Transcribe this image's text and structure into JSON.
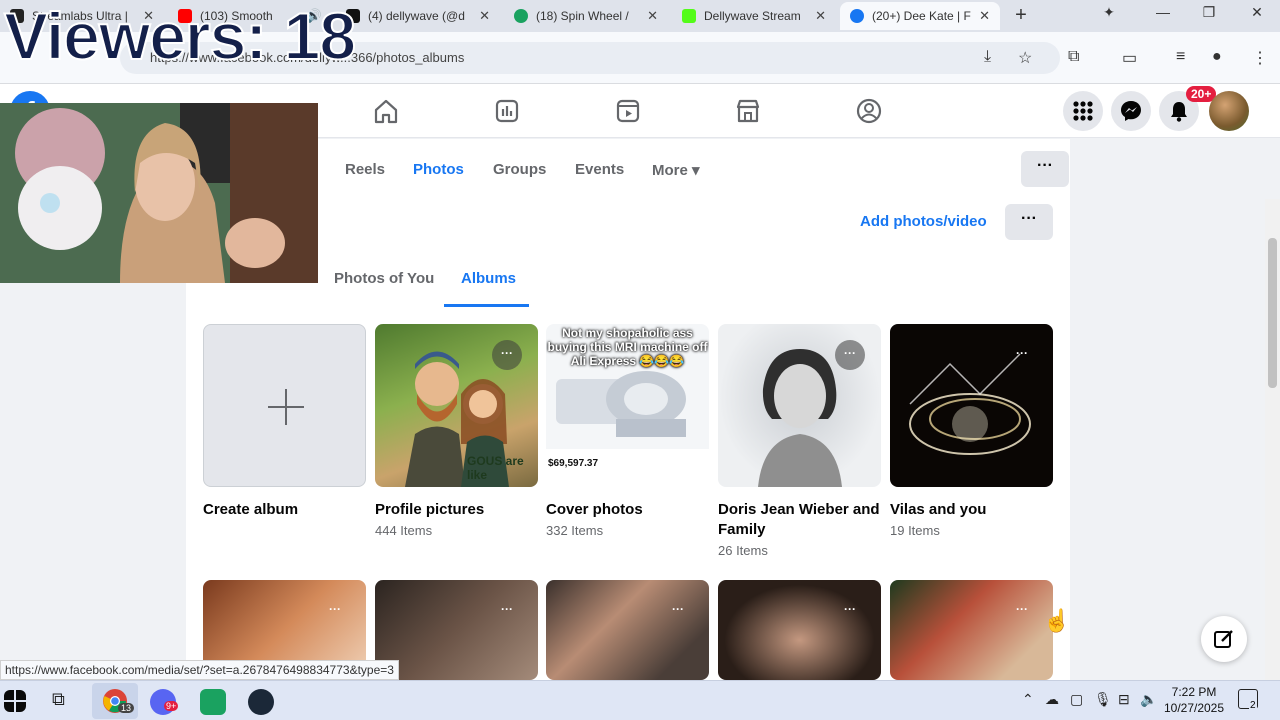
{
  "browser": {
    "tabs": [
      {
        "label": "Streamlabs Ultra |",
        "color": "#222222"
      },
      {
        "label": "(103) Smooth",
        "color": "#ff0000"
      },
      {
        "label": "(4) dellywave (@d",
        "color": "#111111"
      },
      {
        "label": "(18) Spin Wheel /",
        "color": "#1aa260"
      },
      {
        "label": "Dellywave Stream",
        "color": "#53fc18"
      },
      {
        "label": "(20+) Dee Kate | F",
        "color": "#1877f2"
      }
    ],
    "url": "https://www.facebook.com/dellyw...366/photos_albums",
    "status_url": "https://www.facebook.com/media/set/?set=a.2678476498834773&type=3"
  },
  "overlay": {
    "viewers_text": "Viewers: 18"
  },
  "facebook": {
    "notifications_badge": "20+",
    "profile_nav": [
      {
        "label": "Reels",
        "active": false
      },
      {
        "label": "Photos",
        "active": true
      },
      {
        "label": "Groups",
        "active": false
      },
      {
        "label": "Events",
        "active": false
      },
      {
        "label": "More ▾",
        "active": false
      }
    ],
    "add_photos_label": "Add photos/video",
    "more_dots": "···",
    "subtabs": [
      {
        "label": "Photos of You",
        "active": false
      },
      {
        "label": "Albums",
        "active": true
      }
    ],
    "albums": [
      {
        "title": "Create album",
        "count": ""
      },
      {
        "title": "Profile pictures",
        "count": "444 Items"
      },
      {
        "title": "Cover photos",
        "count": "332 Items"
      },
      {
        "title": "Doris Jean Wieber and Family",
        "count": "26 Items"
      },
      {
        "title": "Vilas and you",
        "count": "19 Items"
      }
    ],
    "cover_caption": "Not my shopaholic ass buying this MRI machine off Ali Express 😂😂😂",
    "cover_price": "$69,597.37",
    "profile_pic_text": "GOUS are like"
  },
  "taskbar": {
    "time": "7:22 PM",
    "date": "10/27/2025",
    "chrome_badge": "13",
    "discord_badge": "9+",
    "notification_count": "2"
  }
}
